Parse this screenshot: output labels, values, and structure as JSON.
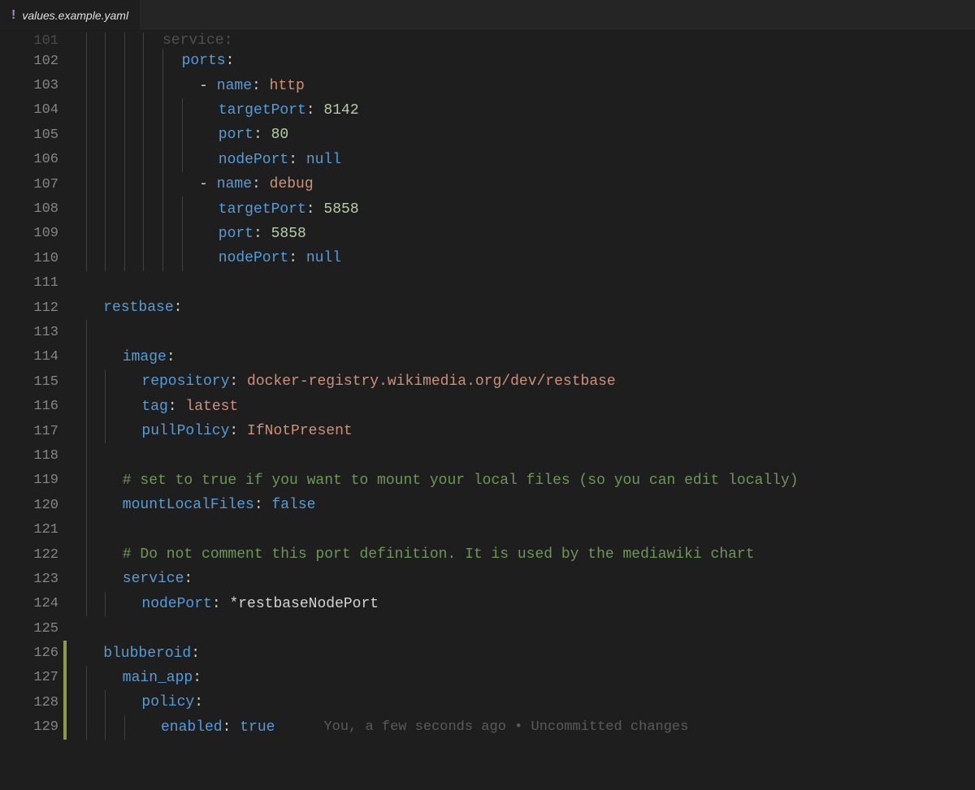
{
  "tab": {
    "icon": "!",
    "filename": "values.example.yaml"
  },
  "lines": [
    {
      "num": "101",
      "indent": 4,
      "cut": true,
      "tokens": [
        {
          "t": "service",
          "c": "tok-key faded"
        },
        {
          "t": ":",
          "c": "tok-punc faded"
        }
      ]
    },
    {
      "num": "102",
      "indent": 5,
      "tokens": [
        {
          "t": "ports",
          "c": "tok-key"
        },
        {
          "t": ":",
          "c": "tok-punc"
        }
      ]
    },
    {
      "num": "103",
      "indent": 5,
      "tokens": [
        {
          "t": "  ",
          "c": ""
        },
        {
          "t": "-",
          "c": "tok-dash"
        },
        {
          "t": " ",
          "c": ""
        },
        {
          "t": "name",
          "c": "tok-key"
        },
        {
          "t": ":",
          "c": "tok-punc"
        },
        {
          "t": " ",
          "c": ""
        },
        {
          "t": "http",
          "c": "tok-str"
        }
      ]
    },
    {
      "num": "104",
      "indent": 6,
      "tokens": [
        {
          "t": "  ",
          "c": ""
        },
        {
          "t": "targetPort",
          "c": "tok-key"
        },
        {
          "t": ":",
          "c": "tok-punc"
        },
        {
          "t": " ",
          "c": ""
        },
        {
          "t": "8142",
          "c": "tok-num"
        }
      ]
    },
    {
      "num": "105",
      "indent": 6,
      "tokens": [
        {
          "t": "  ",
          "c": ""
        },
        {
          "t": "port",
          "c": "tok-key"
        },
        {
          "t": ":",
          "c": "tok-punc"
        },
        {
          "t": " ",
          "c": ""
        },
        {
          "t": "80",
          "c": "tok-num"
        }
      ]
    },
    {
      "num": "106",
      "indent": 6,
      "tokens": [
        {
          "t": "  ",
          "c": ""
        },
        {
          "t": "nodePort",
          "c": "tok-key"
        },
        {
          "t": ":",
          "c": "tok-punc"
        },
        {
          "t": " ",
          "c": ""
        },
        {
          "t": "null",
          "c": "tok-null"
        }
      ]
    },
    {
      "num": "107",
      "indent": 5,
      "tokens": [
        {
          "t": "  ",
          "c": ""
        },
        {
          "t": "-",
          "c": "tok-dash"
        },
        {
          "t": " ",
          "c": ""
        },
        {
          "t": "name",
          "c": "tok-key"
        },
        {
          "t": ":",
          "c": "tok-punc"
        },
        {
          "t": " ",
          "c": ""
        },
        {
          "t": "debug",
          "c": "tok-str"
        }
      ]
    },
    {
      "num": "108",
      "indent": 6,
      "tokens": [
        {
          "t": "  ",
          "c": ""
        },
        {
          "t": "targetPort",
          "c": "tok-key"
        },
        {
          "t": ":",
          "c": "tok-punc"
        },
        {
          "t": " ",
          "c": ""
        },
        {
          "t": "5858",
          "c": "tok-num"
        }
      ]
    },
    {
      "num": "109",
      "indent": 6,
      "tokens": [
        {
          "t": "  ",
          "c": ""
        },
        {
          "t": "port",
          "c": "tok-key"
        },
        {
          "t": ":",
          "c": "tok-punc"
        },
        {
          "t": " ",
          "c": ""
        },
        {
          "t": "5858",
          "c": "tok-num"
        }
      ]
    },
    {
      "num": "110",
      "indent": 6,
      "tokens": [
        {
          "t": "  ",
          "c": ""
        },
        {
          "t": "nodePort",
          "c": "tok-key"
        },
        {
          "t": ":",
          "c": "tok-punc"
        },
        {
          "t": " ",
          "c": ""
        },
        {
          "t": "null",
          "c": "tok-null"
        }
      ]
    },
    {
      "num": "111",
      "indent": 0,
      "tokens": []
    },
    {
      "num": "112",
      "indent": 0,
      "tokens": [
        {
          "t": "  ",
          "c": ""
        },
        {
          "t": "restbase",
          "c": "tok-key"
        },
        {
          "t": ":",
          "c": "tok-punc"
        }
      ]
    },
    {
      "num": "113",
      "indent": 1,
      "tokens": []
    },
    {
      "num": "114",
      "indent": 1,
      "tokens": [
        {
          "t": "  ",
          "c": ""
        },
        {
          "t": "image",
          "c": "tok-key"
        },
        {
          "t": ":",
          "c": "tok-punc"
        }
      ]
    },
    {
      "num": "115",
      "indent": 2,
      "tokens": [
        {
          "t": "  ",
          "c": ""
        },
        {
          "t": "repository",
          "c": "tok-key"
        },
        {
          "t": ":",
          "c": "tok-punc"
        },
        {
          "t": " ",
          "c": ""
        },
        {
          "t": "docker-registry.wikimedia.org/dev/restbase",
          "c": "tok-str"
        }
      ]
    },
    {
      "num": "116",
      "indent": 2,
      "tokens": [
        {
          "t": "  ",
          "c": ""
        },
        {
          "t": "tag",
          "c": "tok-key"
        },
        {
          "t": ":",
          "c": "tok-punc"
        },
        {
          "t": " ",
          "c": ""
        },
        {
          "t": "latest",
          "c": "tok-str"
        }
      ]
    },
    {
      "num": "117",
      "indent": 2,
      "tokens": [
        {
          "t": "  ",
          "c": ""
        },
        {
          "t": "pullPolicy",
          "c": "tok-key"
        },
        {
          "t": ":",
          "c": "tok-punc"
        },
        {
          "t": " ",
          "c": ""
        },
        {
          "t": "IfNotPresent",
          "c": "tok-str"
        }
      ]
    },
    {
      "num": "118",
      "indent": 1,
      "tokens": []
    },
    {
      "num": "119",
      "indent": 1,
      "tokens": [
        {
          "t": "  ",
          "c": ""
        },
        {
          "t": "# set to true if you want to mount your local files (so you can edit locally)",
          "c": "tok-comment"
        }
      ]
    },
    {
      "num": "120",
      "indent": 1,
      "tokens": [
        {
          "t": "  ",
          "c": ""
        },
        {
          "t": "mountLocalFiles",
          "c": "tok-key"
        },
        {
          "t": ":",
          "c": "tok-punc"
        },
        {
          "t": " ",
          "c": ""
        },
        {
          "t": "false",
          "c": "tok-bool"
        }
      ]
    },
    {
      "num": "121",
      "indent": 1,
      "tokens": []
    },
    {
      "num": "122",
      "indent": 1,
      "tokens": [
        {
          "t": "  ",
          "c": ""
        },
        {
          "t": "# Do not comment this port definition. It is used by the mediawiki chart",
          "c": "tok-comment"
        }
      ]
    },
    {
      "num": "123",
      "indent": 1,
      "tokens": [
        {
          "t": "  ",
          "c": ""
        },
        {
          "t": "service",
          "c": "tok-key"
        },
        {
          "t": ":",
          "c": "tok-punc"
        }
      ]
    },
    {
      "num": "124",
      "indent": 2,
      "tokens": [
        {
          "t": "  ",
          "c": ""
        },
        {
          "t": "nodePort",
          "c": "tok-key"
        },
        {
          "t": ":",
          "c": "tok-punc"
        },
        {
          "t": " ",
          "c": ""
        },
        {
          "t": "*",
          "c": "tok-star"
        },
        {
          "t": "restbaseNodePort",
          "c": "tok-alias"
        }
      ]
    },
    {
      "num": "125",
      "indent": 0,
      "tokens": []
    },
    {
      "num": "126",
      "indent": 0,
      "mod": true,
      "tokens": [
        {
          "t": "  ",
          "c": ""
        },
        {
          "t": "blubberoid",
          "c": "tok-key"
        },
        {
          "t": ":",
          "c": "tok-punc"
        }
      ]
    },
    {
      "num": "127",
      "indent": 1,
      "mod": true,
      "tokens": [
        {
          "t": "  ",
          "c": ""
        },
        {
          "t": "main_app",
          "c": "tok-key"
        },
        {
          "t": ":",
          "c": "tok-punc"
        }
      ]
    },
    {
      "num": "128",
      "indent": 2,
      "mod": true,
      "tokens": [
        {
          "t": "  ",
          "c": ""
        },
        {
          "t": "policy",
          "c": "tok-key"
        },
        {
          "t": ":",
          "c": "tok-punc"
        }
      ]
    },
    {
      "num": "129",
      "indent": 3,
      "mod": true,
      "blame": "You, a few seconds ago • Uncommitted changes",
      "tokens": [
        {
          "t": "  ",
          "c": ""
        },
        {
          "t": "enabled",
          "c": "tok-key"
        },
        {
          "t": ":",
          "c": "tok-punc"
        },
        {
          "t": " ",
          "c": ""
        },
        {
          "t": "true",
          "c": "tok-bool"
        }
      ]
    }
  ]
}
